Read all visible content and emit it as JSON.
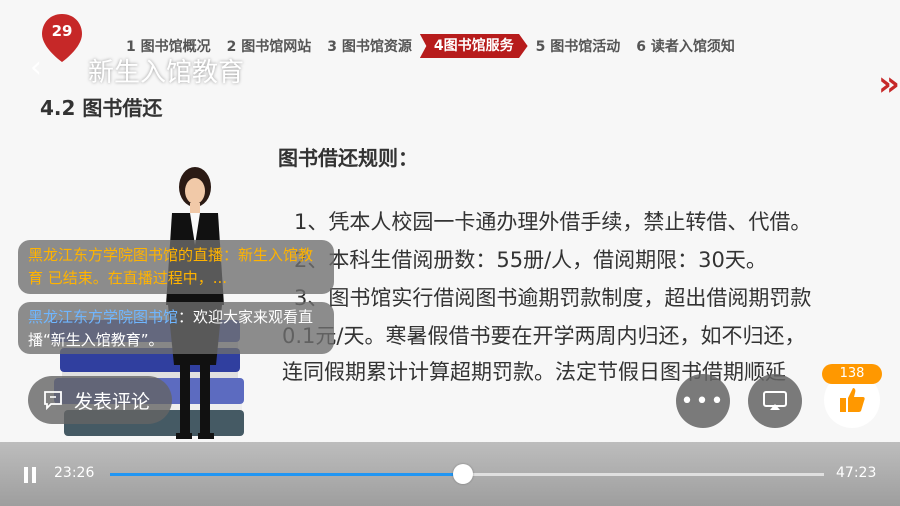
{
  "badge": {
    "count": "29"
  },
  "nav": {
    "back_label": "‹",
    "title": "新生入馆教育"
  },
  "slide": {
    "tabs": [
      {
        "label": "1 图书馆概况"
      },
      {
        "label": "2 图书馆网站"
      },
      {
        "label": "3 图书馆资源"
      },
      {
        "label": "4图书馆服务"
      },
      {
        "label": "5 图书馆活动"
      },
      {
        "label": "6 读者入馆须知"
      }
    ],
    "active_tab": 3,
    "section_heading": "4.2 图书借还",
    "rules_title": "图书借还规则：",
    "lines": [
      "1、凭本人校园一卡通办理外借手续，禁止转借、代借。",
      "2、本科生借阅册数：55册/人，借阅期限：30天。",
      "3、图书馆实行借阅图书逾期罚款制度，超出借阅期罚款",
      "0.1元/天。寒暑假借书要在开学两周内归还，如不归还，",
      "连同假期累计计算超期罚款。法定节假日图书借期顺延"
    ],
    "chevron": "»"
  },
  "chat": [
    {
      "name": "黑龙江东方学院图书馆的直播：新生入馆教育 已结束。在直播过程中，...",
      "text": ""
    },
    {
      "name": "黑龙江东方学院图书馆",
      "text": "：欢迎大家来观看直播“新生入馆教育”。"
    }
  ],
  "actions": {
    "comment_label": "发表评论",
    "more_label": "•••",
    "like_count": "138"
  },
  "player": {
    "current_time": "23:26",
    "total_time": "47:23",
    "progress": 0.495
  },
  "colors": {
    "accent_red": "#b71c1c",
    "progress_blue": "#2196f3",
    "like_orange": "#ff9800"
  },
  "icons": [
    "location-pin-icon",
    "back-arrow-icon",
    "comment-icon",
    "more-icon",
    "cast-icon",
    "thumbs-up-icon",
    "pause-icon",
    "double-chevron-icon"
  ]
}
